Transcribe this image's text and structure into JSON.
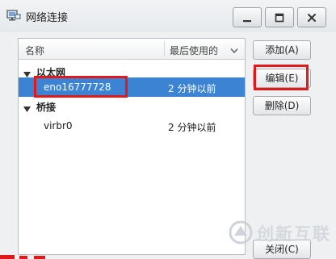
{
  "window": {
    "title": "网络连接",
    "controls": [
      "minimize-icon",
      "maximize-icon",
      "close-icon"
    ]
  },
  "list": {
    "columns": {
      "name": "名称",
      "last_used": "最后使用的"
    },
    "groups": [
      {
        "label": "以太网",
        "connections": [
          {
            "name": "eno16777728",
            "last_used": "2 分钟以前",
            "selected": true
          }
        ]
      },
      {
        "label": "桥接",
        "connections": [
          {
            "name": "virbr0",
            "last_used": "2 分钟以前",
            "selected": false
          }
        ]
      }
    ]
  },
  "actions": {
    "add": "添加(A)",
    "edit": "编辑(E)",
    "delete": "删除(D)",
    "close": "关闭(C)"
  },
  "watermark": {
    "text": "创新互联"
  },
  "colors": {
    "selection": "#3c83d4",
    "highlight_box": "#e01a1a"
  }
}
